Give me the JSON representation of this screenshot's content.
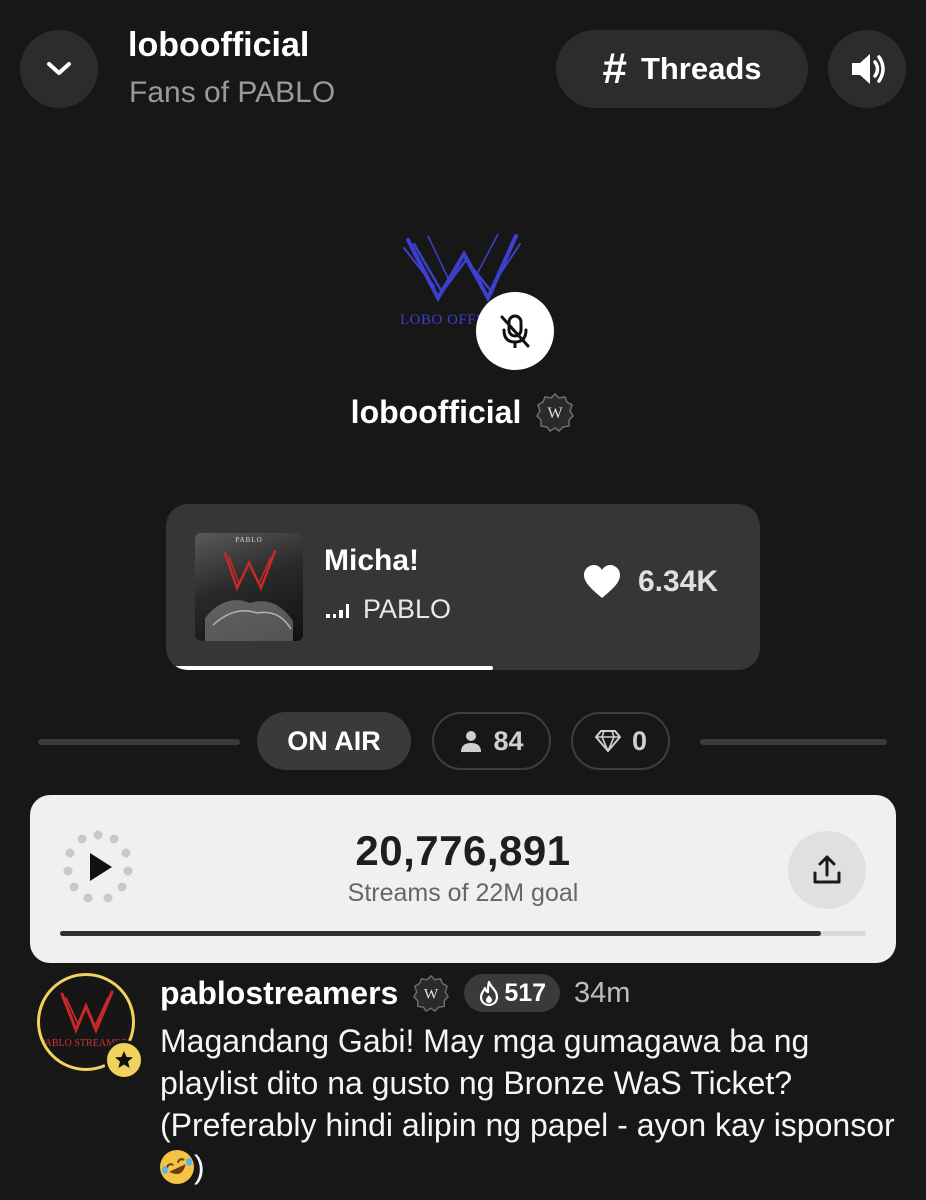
{
  "header": {
    "title": "loboofficial",
    "subtitle": "Fans of PABLO",
    "threads_label": "Threads",
    "icons": {
      "back": "chevron-down-icon",
      "threads": "hash-icon",
      "sound": "speaker-icon"
    }
  },
  "host": {
    "name": "loboofficial",
    "logo_caption": "LOBO OFFICIAL",
    "badge_letter": "W",
    "mic_state": "muted",
    "icons": {
      "mic": "mic-off-icon",
      "badge": "verified-w-badge-icon"
    }
  },
  "now_playing": {
    "title": "Micha!",
    "artist": "PABLO",
    "album_art_label": "PABLO",
    "likes": "6.34K",
    "progress": 0.55,
    "icons": {
      "like": "heart-icon",
      "playing": "equalizer-icon"
    }
  },
  "status": {
    "on_air_label": "ON AIR",
    "listeners": "84",
    "gems": "0",
    "icons": {
      "listeners": "person-icon",
      "gems": "diamond-icon"
    }
  },
  "goal": {
    "count": "20,776,891",
    "label": "Streams of 22M goal",
    "progress": 0.944,
    "icons": {
      "play": "play-icon",
      "share": "share-icon"
    }
  },
  "comment": {
    "user": "pablostreamers",
    "badge_letter": "W",
    "avatar_caption": "PABLO STREAMERS",
    "streak": "517",
    "time": "34m",
    "text": "Magandang Gabi! May mga gumagawa ba ng playlist dito na gusto ng Bronze WaS Ticket? (Preferably hindi alipin ng papel - ayon kay isponsor",
    "text_end": ")",
    "icons": {
      "streak": "fire-icon",
      "star": "star-icon",
      "emoji": "rolling-laughing-emoji"
    }
  },
  "colors": {
    "background": "#171717",
    "surface": "#2c2c2e",
    "card": "#363636",
    "goal_card": "#f0f0f0",
    "logo_blue": "#3d3fd0",
    "logo_red": "#c82828",
    "gold": "#f0d25c"
  }
}
